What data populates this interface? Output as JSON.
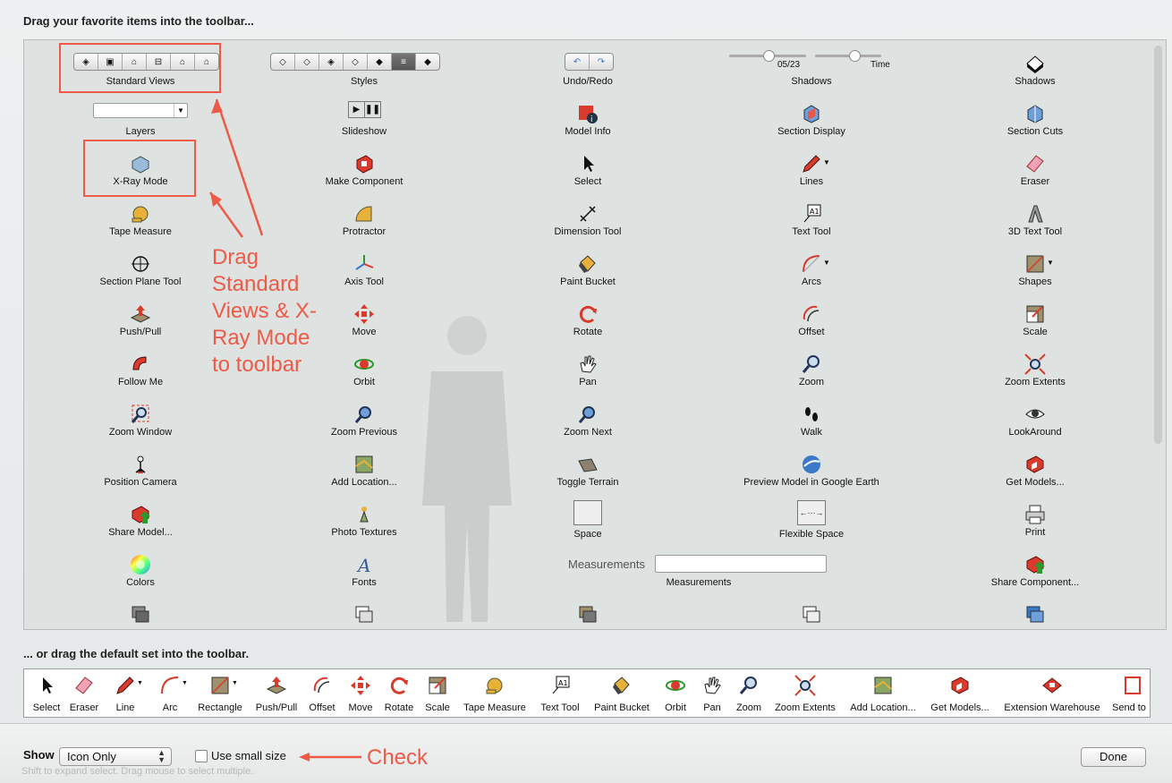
{
  "header": {
    "title": "Drag your favorite items into the toolbar..."
  },
  "palette": {
    "standard_views": "Standard Views",
    "styles": "Styles",
    "undo_redo": "Undo/Redo",
    "shadows_slider": {
      "date": "05/23",
      "time": "Time",
      "label": "Shadows"
    },
    "shadows": "Shadows",
    "layers": "Layers",
    "slideshow": "Slideshow",
    "model_info": "Model Info",
    "section_display": "Section Display",
    "section_cuts": "Section Cuts",
    "xray_mode": "X-Ray Mode",
    "make_component": "Make Component",
    "select": "Select",
    "lines": "Lines",
    "eraser": "Eraser",
    "tape_measure": "Tape Measure",
    "protractor": "Protractor",
    "dimension_tool": "Dimension Tool",
    "text_tool": "Text Tool",
    "text3d_tool": "3D Text Tool",
    "section_plane_tool": "Section Plane Tool",
    "axis_tool": "Axis Tool",
    "paint_bucket": "Paint Bucket",
    "arcs": "Arcs",
    "shapes": "Shapes",
    "push_pull": "Push/Pull",
    "move": "Move",
    "rotate": "Rotate",
    "offset": "Offset",
    "scale": "Scale",
    "follow_me": "Follow Me",
    "orbit": "Orbit",
    "pan": "Pan",
    "zoom": "Zoom",
    "zoom_extents": "Zoom Extents",
    "zoom_window": "Zoom Window",
    "zoom_previous": "Zoom Previous",
    "zoom_next": "Zoom Next",
    "walk": "Walk",
    "lookaround": "LookAround",
    "position_camera": "Position Camera",
    "add_location": "Add Location...",
    "toggle_terrain": "Toggle Terrain",
    "preview_google_earth": "Preview Model in Google Earth",
    "get_models": "Get Models...",
    "share_model": "Share Model...",
    "photo_textures": "Photo Textures",
    "space": "Space",
    "flexible_space": "Flexible Space",
    "print": "Print",
    "colors": "Colors",
    "fonts": "Fonts",
    "measurements_field_label": "Measurements",
    "measurements": "Measurements",
    "share_component": "Share Component..."
  },
  "annotations": {
    "drag_note": "Drag Standard Views & X-Ray Mode to toolbar",
    "check_note": "Check"
  },
  "default_set": {
    "title": "... or drag the default set into the toolbar.",
    "items": [
      "Select",
      "Eraser",
      "Line",
      "Arc",
      "Rectangle",
      "Push/Pull",
      "Offset",
      "Move",
      "Rotate",
      "Scale",
      "Tape Measure",
      "Text Tool",
      "Paint Bucket",
      "Orbit",
      "Pan",
      "Zoom",
      "Zoom Extents",
      "Add Location...",
      "Get Models...",
      "Extension Warehouse",
      "Send to"
    ]
  },
  "footer": {
    "show_label": "Show",
    "show_value": "Icon Only",
    "small_size_label": "Use small size",
    "done_label": "Done",
    "hint": "Shift to expand select. Drag mouse to select multiple."
  },
  "colors": {
    "annotation": "#ee5a47",
    "icon_red": "#d93a2b",
    "icon_blue": "#3a78c8"
  }
}
